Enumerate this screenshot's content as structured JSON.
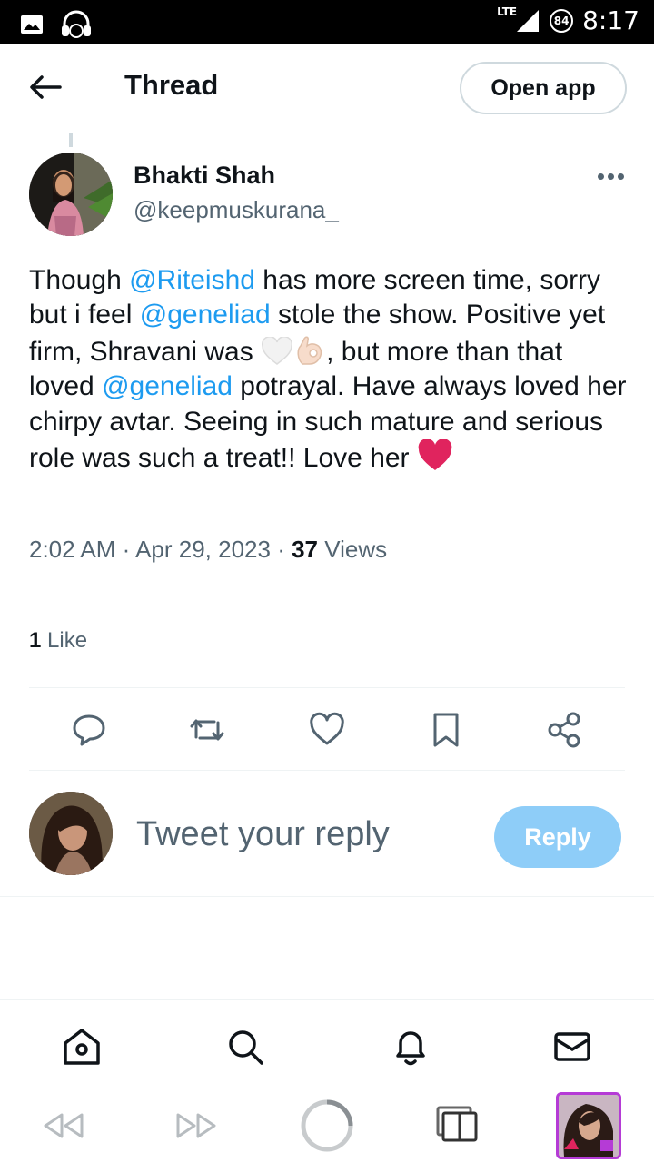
{
  "status_bar": {
    "time": "8:17",
    "network": "LTE",
    "battery": "84"
  },
  "header": {
    "title": "Thread",
    "open_app_label": "Open app"
  },
  "tweet": {
    "author_name": "Bhakti Shah",
    "author_handle": "@keepmuskurana_",
    "text_parts": {
      "p1": "Though ",
      "m1": "@Riteishd",
      "p2": " has more screen time, sorry but i feel ",
      "m2": "@geneliad",
      "p3": " stole the show. Positive yet firm, Shravani was ",
      "p4": ", but more than that loved ",
      "m3": "@geneliad",
      "p5": " potrayal. Have always loved her chirpy avtar. Seeing in such mature and serious role was such a treat!! Love her "
    },
    "time": "2:02 AM",
    "date": "Apr 29, 2023",
    "views_count": "37",
    "views_label": "Views",
    "likes_count": "1",
    "likes_label": "Like"
  },
  "reply": {
    "placeholder": "Tweet your reply",
    "button_label": "Reply"
  },
  "colors": {
    "accent": "#1d9bf0",
    "reply_button": "#8ecdf8",
    "secondary_text": "#536471",
    "heart": "#e0245e"
  },
  "icons": {
    "actions": [
      "comment-icon",
      "retweet-icon",
      "like-icon",
      "bookmark-icon",
      "share-icon"
    ],
    "nav": [
      "home-icon",
      "search-icon",
      "notifications-icon",
      "messages-icon"
    ],
    "browser": [
      "back-icon",
      "forward-icon",
      "loading-icon",
      "tabs-icon"
    ]
  }
}
